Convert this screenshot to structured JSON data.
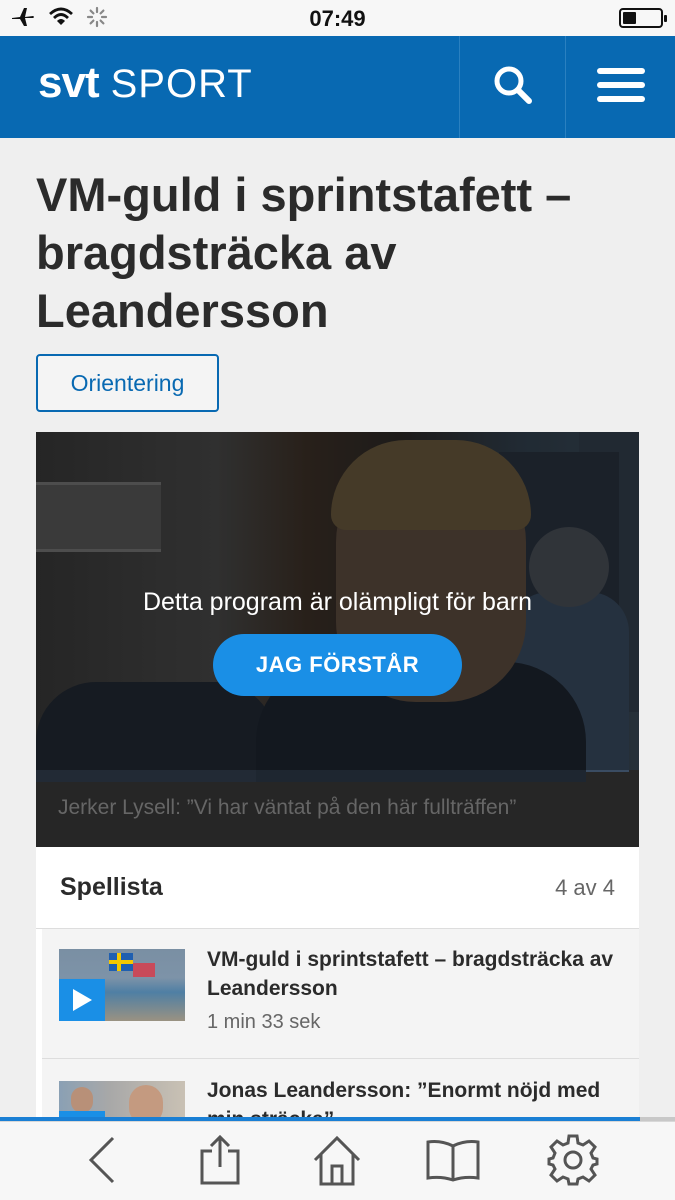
{
  "status_bar": {
    "time": "07:49",
    "icons": [
      "airplane-icon",
      "wifi-icon",
      "activity-spinner-icon",
      "battery-icon"
    ],
    "battery_level": 0.35
  },
  "header": {
    "logo_svt": "svt",
    "logo_sport": "SPORT",
    "search_icon": "search-icon",
    "menu_icon": "hamburger-menu-icon",
    "color": "#0869b2"
  },
  "article": {
    "headline": "VM-guld i sprintstafett – bragdsträcka av Leandersson",
    "tag": "Orientering"
  },
  "video": {
    "warning": "Detta program är olämpligt för barn",
    "confirm_label": "JAG FÖRSTÅR",
    "caption": "Jerker Lysell: ”Vi har väntat på den här fullträffen”"
  },
  "playlist": {
    "title": "Spellista",
    "count": "4 av 4",
    "items": [
      {
        "title": "VM-guld i sprintstafett – bragdsträcka av Leandersson",
        "duration": "1 min 33 sek"
      },
      {
        "title": "Jonas Leandersson: ”Enormt nöjd med min sträcka”",
        "duration": ""
      }
    ]
  },
  "page_load_progress": 0.95,
  "toolbar": {
    "icons": [
      "back-icon",
      "share-icon",
      "home-icon",
      "bookmarks-icon",
      "settings-icon"
    ]
  },
  "colors": {
    "accent": "#1a8fe6",
    "brand": "#0869b2"
  }
}
